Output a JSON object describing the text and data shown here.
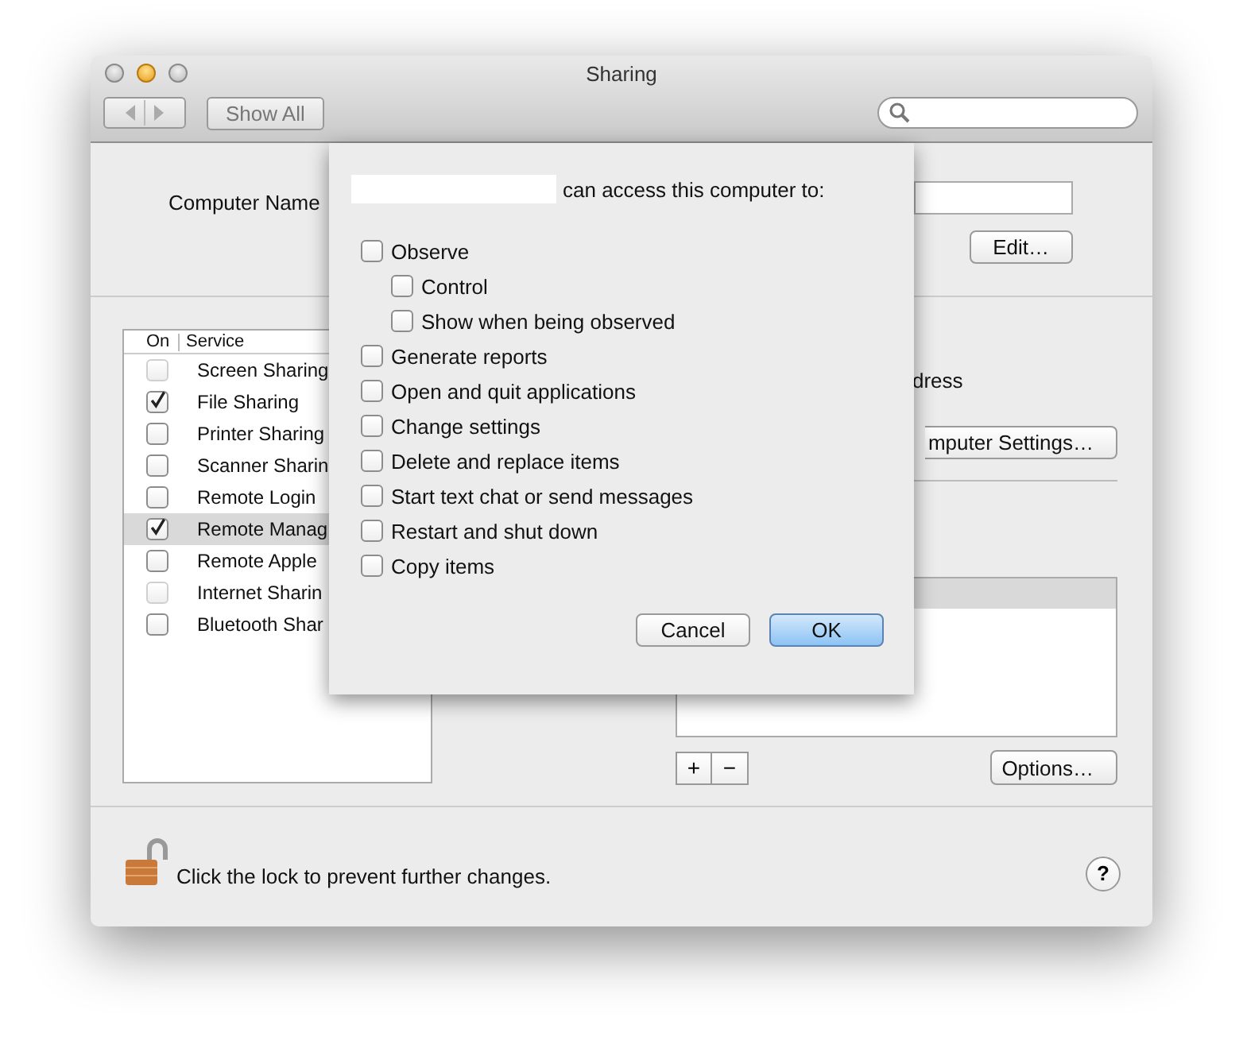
{
  "window": {
    "title": "Sharing"
  },
  "toolbar": {
    "show_all": "Show All"
  },
  "computer_name": {
    "label": "Computer Name",
    "edit_button": "Edit…"
  },
  "services": {
    "columns": [
      "On",
      "Service"
    ],
    "items": [
      {
        "name": "Screen Sharing",
        "on": false,
        "disabled": true,
        "selected": false
      },
      {
        "name": "File Sharing",
        "on": true,
        "disabled": false,
        "selected": false
      },
      {
        "name": "Printer Sharing",
        "on": false,
        "disabled": false,
        "selected": false
      },
      {
        "name": "Scanner Sharin",
        "on": false,
        "disabled": false,
        "selected": false
      },
      {
        "name": "Remote Login",
        "on": false,
        "disabled": false,
        "selected": false
      },
      {
        "name": "Remote Manag",
        "on": true,
        "disabled": false,
        "selected": true
      },
      {
        "name": "Remote Apple",
        "on": false,
        "disabled": false,
        "selected": false
      },
      {
        "name": "Internet Sharin",
        "on": false,
        "disabled": true,
        "selected": false
      },
      {
        "name": "Bluetooth Shar",
        "on": false,
        "disabled": false,
        "selected": false
      }
    ]
  },
  "remote_management": {
    "address_fragment": "dress",
    "computer_settings_button": "mputer Settings…",
    "add_button": "+",
    "remove_button": "−",
    "options_button": "Options…"
  },
  "sheet": {
    "prompt": "can access this computer to:",
    "options": [
      {
        "label": "Observe",
        "checked": false,
        "children": [
          {
            "label": "Control",
            "checked": false
          },
          {
            "label": "Show when being observed",
            "checked": false
          }
        ]
      },
      {
        "label": "Generate reports",
        "checked": false
      },
      {
        "label": "Open and quit applications",
        "checked": false
      },
      {
        "label": "Change settings",
        "checked": false
      },
      {
        "label": "Delete and replace items",
        "checked": false
      },
      {
        "label": "Start text chat or send messages",
        "checked": false
      },
      {
        "label": "Restart and shut down",
        "checked": false
      },
      {
        "label": "Copy items",
        "checked": false
      }
    ],
    "buttons": [
      {
        "label": "Cancel",
        "default": false
      },
      {
        "label": "OK",
        "default": true
      }
    ]
  },
  "footer": {
    "lock_text": "Click the lock to prevent further changes.",
    "help": "?"
  }
}
